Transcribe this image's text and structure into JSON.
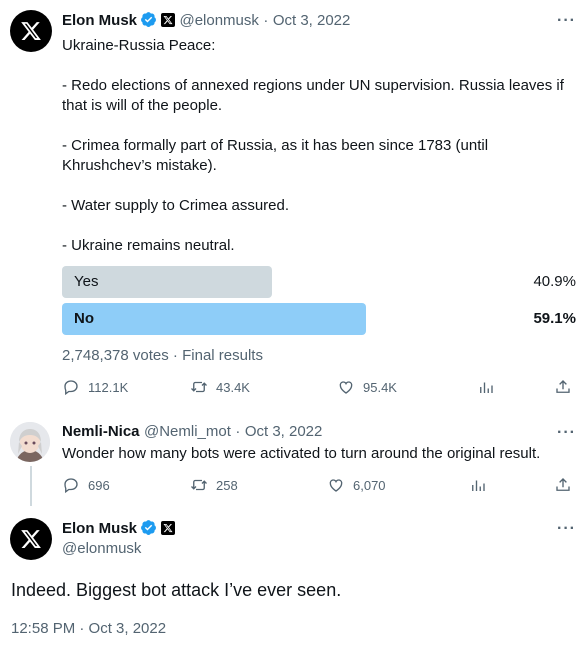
{
  "tweet1": {
    "name": "Elon Musk",
    "handle": "@elonmusk",
    "date": "Oct 3, 2022",
    "sep": "·",
    "more": "···",
    "lines": [
      "Ukraine-Russia Peace:",
      "- Redo elections of annexed regions under UN supervision. Russia leaves if",
      "that is will of the people.",
      "- Crimea formally part of Russia, as it has been since 1783 (until",
      "Khrushchev’s mistake).",
      "- Water supply to Crimea assured.",
      "- Ukraine remains neutral."
    ],
    "poll": {
      "options": [
        {
          "label": "Yes",
          "percent_text": "40.9%",
          "percent": 40.9,
          "winner": false
        },
        {
          "label": "No",
          "percent_text": "59.1%",
          "percent": 59.1,
          "winner": true
        }
      ],
      "votes": "2,748,378 votes",
      "status": "Final results"
    },
    "actions": {
      "replies": "112.1K",
      "retweets": "43.4K",
      "likes": "95.4K"
    }
  },
  "reply": {
    "name": "Nemli-Nica",
    "handle": "@Nemli_mot",
    "date": "Oct 3, 2022",
    "sep": "·",
    "more": "···",
    "text": "Wonder how many bots were activated to turn around the original result.",
    "actions": {
      "replies": "696",
      "retweets": "258",
      "likes": "6,070"
    }
  },
  "tweet2": {
    "name": "Elon Musk",
    "handle": "@elonmusk",
    "more": "···",
    "text": "Indeed. Biggest bot attack I’ve ever seen.",
    "timestamp": "12:58 PM · Oct 3, 2022"
  },
  "colors": {
    "poll_winner": "#8ecdf8",
    "poll_other": "#cfd9de",
    "verified": "#1d9bf0"
  }
}
